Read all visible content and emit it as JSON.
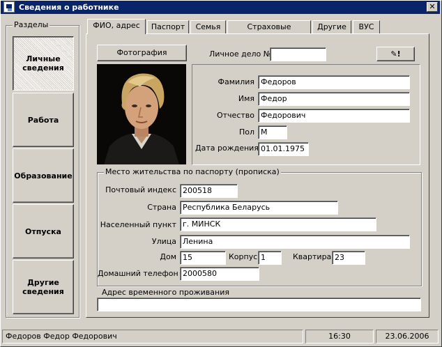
{
  "window": {
    "title": "Сведения о работнике",
    "close_glyph": "✕"
  },
  "sections": {
    "title": "Разделы",
    "items": [
      {
        "label": "Личные сведения"
      },
      {
        "label": "Работа"
      },
      {
        "label": "Образование"
      },
      {
        "label": "Отпуска"
      },
      {
        "label": "Другие сведения"
      }
    ]
  },
  "tabs": [
    {
      "label": "ФИО, адрес"
    },
    {
      "label": "Паспорт"
    },
    {
      "label": "Семья"
    },
    {
      "label": "Страховые сведения"
    },
    {
      "label": "Другие"
    },
    {
      "label": "ВУС"
    }
  ],
  "personal": {
    "photo_button": "Фотография",
    "file_label": "Личное дело №",
    "file_value": "",
    "edit_button_glyph": "✎!",
    "surname_label": "Фамилия",
    "surname": "Федоров",
    "name_label": "Имя",
    "name": "Федор",
    "patronymic_label": "Отчество",
    "patronymic": "Федорович",
    "sex_label": "Пол",
    "sex": "М",
    "birth_label": "Дата рождения",
    "birth_date": "01.01.1975"
  },
  "residence": {
    "title": "Место жительства по паспорту (прописка)",
    "postcode_label": "Почтовый индекс",
    "postcode": "200518",
    "country_label": "Страна",
    "country": "Республика Беларусь",
    "city_label": "Населенный пункт",
    "city": "г. МИНСК",
    "street_label": "Улица",
    "street": "Ленина",
    "house_label": "Дом",
    "house": "15",
    "building_label": "Корпус",
    "building": "1",
    "apartment_label": "Квартира",
    "apartment": "23",
    "phone_label": "Домашний телефон",
    "phone": "2000580"
  },
  "temp_address": {
    "label": "Адрес временного проживания",
    "value": ""
  },
  "status": {
    "employee": "Федоров Федор Федорович",
    "time": "16:30",
    "date": "23.06.2006"
  },
  "colors": {
    "titlebar": "#0a246a",
    "face": "#d4d0c8"
  },
  "icons": {
    "app": "card-file-icon",
    "photo": "employee-photo",
    "edit": "pencil-icon"
  }
}
